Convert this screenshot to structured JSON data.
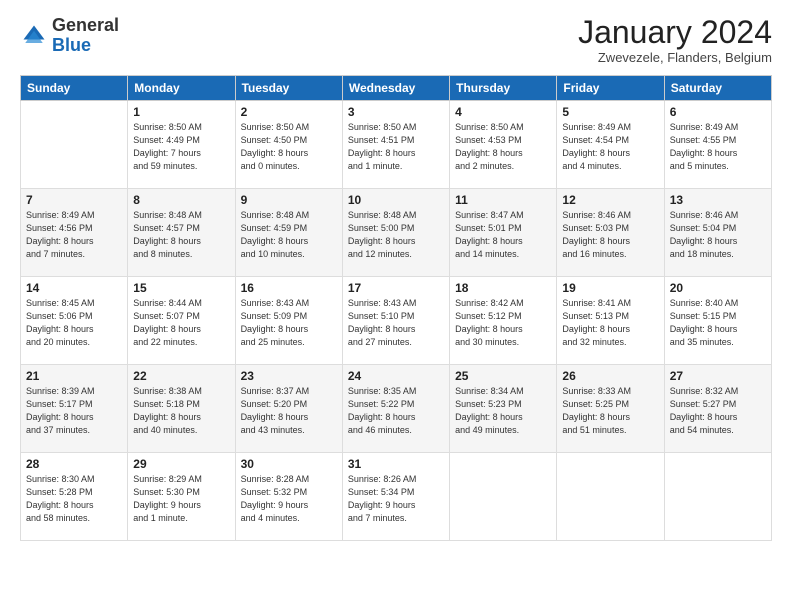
{
  "logo": {
    "general": "General",
    "blue": "Blue"
  },
  "header": {
    "month": "January 2024",
    "location": "Zwevezele, Flanders, Belgium"
  },
  "columns": [
    "Sunday",
    "Monday",
    "Tuesday",
    "Wednesday",
    "Thursday",
    "Friday",
    "Saturday"
  ],
  "weeks": [
    [
      {
        "day": "",
        "info": ""
      },
      {
        "day": "1",
        "info": "Sunrise: 8:50 AM\nSunset: 4:49 PM\nDaylight: 7 hours\nand 59 minutes."
      },
      {
        "day": "2",
        "info": "Sunrise: 8:50 AM\nSunset: 4:50 PM\nDaylight: 8 hours\nand 0 minutes."
      },
      {
        "day": "3",
        "info": "Sunrise: 8:50 AM\nSunset: 4:51 PM\nDaylight: 8 hours\nand 1 minute."
      },
      {
        "day": "4",
        "info": "Sunrise: 8:50 AM\nSunset: 4:53 PM\nDaylight: 8 hours\nand 2 minutes."
      },
      {
        "day": "5",
        "info": "Sunrise: 8:49 AM\nSunset: 4:54 PM\nDaylight: 8 hours\nand 4 minutes."
      },
      {
        "day": "6",
        "info": "Sunrise: 8:49 AM\nSunset: 4:55 PM\nDaylight: 8 hours\nand 5 minutes."
      }
    ],
    [
      {
        "day": "7",
        "info": "Sunrise: 8:49 AM\nSunset: 4:56 PM\nDaylight: 8 hours\nand 7 minutes."
      },
      {
        "day": "8",
        "info": "Sunrise: 8:48 AM\nSunset: 4:57 PM\nDaylight: 8 hours\nand 8 minutes."
      },
      {
        "day": "9",
        "info": "Sunrise: 8:48 AM\nSunset: 4:59 PM\nDaylight: 8 hours\nand 10 minutes."
      },
      {
        "day": "10",
        "info": "Sunrise: 8:48 AM\nSunset: 5:00 PM\nDaylight: 8 hours\nand 12 minutes."
      },
      {
        "day": "11",
        "info": "Sunrise: 8:47 AM\nSunset: 5:01 PM\nDaylight: 8 hours\nand 14 minutes."
      },
      {
        "day": "12",
        "info": "Sunrise: 8:46 AM\nSunset: 5:03 PM\nDaylight: 8 hours\nand 16 minutes."
      },
      {
        "day": "13",
        "info": "Sunrise: 8:46 AM\nSunset: 5:04 PM\nDaylight: 8 hours\nand 18 minutes."
      }
    ],
    [
      {
        "day": "14",
        "info": "Sunrise: 8:45 AM\nSunset: 5:06 PM\nDaylight: 8 hours\nand 20 minutes."
      },
      {
        "day": "15",
        "info": "Sunrise: 8:44 AM\nSunset: 5:07 PM\nDaylight: 8 hours\nand 22 minutes."
      },
      {
        "day": "16",
        "info": "Sunrise: 8:43 AM\nSunset: 5:09 PM\nDaylight: 8 hours\nand 25 minutes."
      },
      {
        "day": "17",
        "info": "Sunrise: 8:43 AM\nSunset: 5:10 PM\nDaylight: 8 hours\nand 27 minutes."
      },
      {
        "day": "18",
        "info": "Sunrise: 8:42 AM\nSunset: 5:12 PM\nDaylight: 8 hours\nand 30 minutes."
      },
      {
        "day": "19",
        "info": "Sunrise: 8:41 AM\nSunset: 5:13 PM\nDaylight: 8 hours\nand 32 minutes."
      },
      {
        "day": "20",
        "info": "Sunrise: 8:40 AM\nSunset: 5:15 PM\nDaylight: 8 hours\nand 35 minutes."
      }
    ],
    [
      {
        "day": "21",
        "info": "Sunrise: 8:39 AM\nSunset: 5:17 PM\nDaylight: 8 hours\nand 37 minutes."
      },
      {
        "day": "22",
        "info": "Sunrise: 8:38 AM\nSunset: 5:18 PM\nDaylight: 8 hours\nand 40 minutes."
      },
      {
        "day": "23",
        "info": "Sunrise: 8:37 AM\nSunset: 5:20 PM\nDaylight: 8 hours\nand 43 minutes."
      },
      {
        "day": "24",
        "info": "Sunrise: 8:35 AM\nSunset: 5:22 PM\nDaylight: 8 hours\nand 46 minutes."
      },
      {
        "day": "25",
        "info": "Sunrise: 8:34 AM\nSunset: 5:23 PM\nDaylight: 8 hours\nand 49 minutes."
      },
      {
        "day": "26",
        "info": "Sunrise: 8:33 AM\nSunset: 5:25 PM\nDaylight: 8 hours\nand 51 minutes."
      },
      {
        "day": "27",
        "info": "Sunrise: 8:32 AM\nSunset: 5:27 PM\nDaylight: 8 hours\nand 54 minutes."
      }
    ],
    [
      {
        "day": "28",
        "info": "Sunrise: 8:30 AM\nSunset: 5:28 PM\nDaylight: 8 hours\nand 58 minutes."
      },
      {
        "day": "29",
        "info": "Sunrise: 8:29 AM\nSunset: 5:30 PM\nDaylight: 9 hours\nand 1 minute."
      },
      {
        "day": "30",
        "info": "Sunrise: 8:28 AM\nSunset: 5:32 PM\nDaylight: 9 hours\nand 4 minutes."
      },
      {
        "day": "31",
        "info": "Sunrise: 8:26 AM\nSunset: 5:34 PM\nDaylight: 9 hours\nand 7 minutes."
      },
      {
        "day": "",
        "info": ""
      },
      {
        "day": "",
        "info": ""
      },
      {
        "day": "",
        "info": ""
      }
    ]
  ]
}
